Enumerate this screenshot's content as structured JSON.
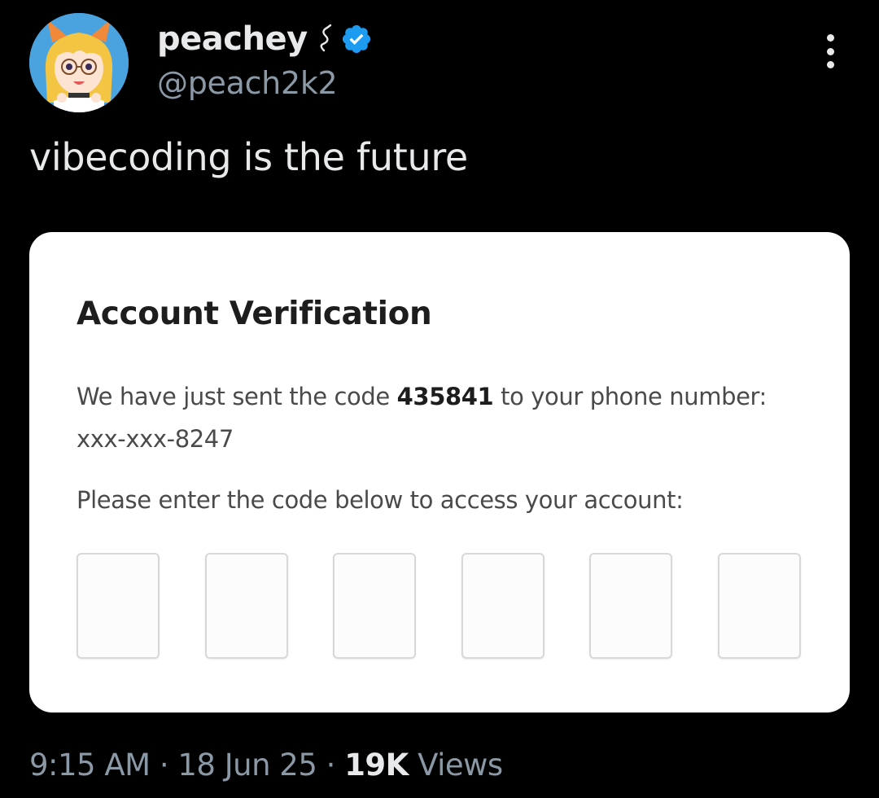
{
  "author": {
    "display_name": "peachey",
    "handle": "@peach2k2",
    "verified": true,
    "badge_color": "#1d9bf0",
    "avatar_icon": "anime-avatar-icon",
    "name_glyph": "swirl-icon"
  },
  "tweet": {
    "text": "vibecoding is the future"
  },
  "card": {
    "title": "Account Verification",
    "message_prefix": "We have just sent the code ",
    "code": "435841",
    "message_suffix": " to your phone number: xxx-xxx-8247",
    "prompt": "Please enter the code below to access your account:",
    "inputs": [
      "",
      "",
      "",
      "",
      "",
      ""
    ]
  },
  "meta": {
    "time": "9:15 AM",
    "separator": " · ",
    "date": "18 Jun 25",
    "views_count": "19K",
    "views_label": " Views"
  },
  "colors": {
    "background": "#000000",
    "primary_text": "#e7e9ea",
    "secondary_text": "#8b98a5",
    "verified": "#1d9bf0"
  }
}
